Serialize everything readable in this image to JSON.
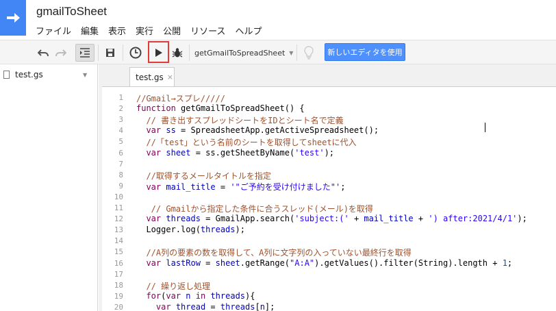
{
  "app": {
    "title": "gmailToSheet"
  },
  "menu": [
    "ファイル",
    "編集",
    "表示",
    "実行",
    "公開",
    "リソース",
    "ヘルプ"
  ],
  "toolbar": {
    "function_name": "getGmailToSpreadSheet",
    "new_editor_label": "新しいエディタを使用"
  },
  "sidebar": {
    "files": [
      {
        "name": "test.gs"
      }
    ]
  },
  "editor": {
    "tab_label": "test.gs",
    "tab_close": "×",
    "lines": [
      {
        "n": "1",
        "parts": [
          {
            "t": "//Gmail→スプレ/////",
            "c": "comment"
          }
        ]
      },
      {
        "n": "2",
        "parts": [
          {
            "t": "function",
            "c": "kw"
          },
          {
            "t": " getGmailToSpreadSheet() {",
            "c": "plain"
          }
        ]
      },
      {
        "n": "3",
        "parts": [
          {
            "t": "  // 書き出すスプレッドシートをIDとシート名で定義",
            "c": "comment"
          }
        ]
      },
      {
        "n": "4",
        "parts": [
          {
            "t": "  ",
            "c": "plain"
          },
          {
            "t": "var",
            "c": "kw"
          },
          {
            "t": " ",
            "c": "plain"
          },
          {
            "t": "ss",
            "c": "var"
          },
          {
            "t": " = SpreadsheetApp.getActiveSpreadsheet(); ",
            "c": "plain"
          }
        ]
      },
      {
        "n": "5",
        "parts": [
          {
            "t": "  //「test」という名前のシートを取得してsheetに代入",
            "c": "comment"
          }
        ]
      },
      {
        "n": "6",
        "parts": [
          {
            "t": "  ",
            "c": "plain"
          },
          {
            "t": "var",
            "c": "kw"
          },
          {
            "t": " ",
            "c": "plain"
          },
          {
            "t": "sheet",
            "c": "var"
          },
          {
            "t": " = ss.getSheetByName(",
            "c": "plain"
          },
          {
            "t": "'test'",
            "c": "str"
          },
          {
            "t": ");",
            "c": "plain"
          }
        ]
      },
      {
        "n": "7",
        "parts": [
          {
            "t": "",
            "c": "plain"
          }
        ]
      },
      {
        "n": "8",
        "parts": [
          {
            "t": "  //取得するメールタイトルを指定",
            "c": "comment"
          }
        ]
      },
      {
        "n": "9",
        "parts": [
          {
            "t": "  ",
            "c": "plain"
          },
          {
            "t": "var",
            "c": "kw"
          },
          {
            "t": " ",
            "c": "plain"
          },
          {
            "t": "mail_title",
            "c": "var"
          },
          {
            "t": " = ",
            "c": "plain"
          },
          {
            "t": "'\"ご予約を受け付けました\"'",
            "c": "str"
          },
          {
            "t": ";",
            "c": "plain"
          }
        ]
      },
      {
        "n": "10",
        "parts": [
          {
            "t": "",
            "c": "plain"
          }
        ]
      },
      {
        "n": "11",
        "parts": [
          {
            "t": "   // Gmailから指定した条件に合うスレッド(メール)を取得",
            "c": "comment"
          }
        ]
      },
      {
        "n": "12",
        "parts": [
          {
            "t": "  ",
            "c": "plain"
          },
          {
            "t": "var",
            "c": "kw"
          },
          {
            "t": " ",
            "c": "plain"
          },
          {
            "t": "threads",
            "c": "var"
          },
          {
            "t": " = GmailApp.search(",
            "c": "plain"
          },
          {
            "t": "'subject:('",
            "c": "str"
          },
          {
            "t": " + ",
            "c": "plain"
          },
          {
            "t": "mail_title",
            "c": "var"
          },
          {
            "t": " + ",
            "c": "plain"
          },
          {
            "t": "') after:2021/4/1'",
            "c": "str"
          },
          {
            "t": ");",
            "c": "plain"
          }
        ]
      },
      {
        "n": "13",
        "parts": [
          {
            "t": "  Logger.log(",
            "c": "plain"
          },
          {
            "t": "threads",
            "c": "var"
          },
          {
            "t": ");",
            "c": "plain"
          }
        ]
      },
      {
        "n": "14",
        "parts": [
          {
            "t": "",
            "c": "plain"
          }
        ]
      },
      {
        "n": "15",
        "parts": [
          {
            "t": "  //A列の要素の数を取得して、A列に文字列の入っていない最終行を取得",
            "c": "comment"
          }
        ]
      },
      {
        "n": "16",
        "parts": [
          {
            "t": "  ",
            "c": "plain"
          },
          {
            "t": "var",
            "c": "kw"
          },
          {
            "t": " ",
            "c": "plain"
          },
          {
            "t": "lastRow",
            "c": "var"
          },
          {
            "t": " = ",
            "c": "plain"
          },
          {
            "t": "sheet",
            "c": "var"
          },
          {
            "t": ".getRange(",
            "c": "plain"
          },
          {
            "t": "\"A:A\"",
            "c": "str"
          },
          {
            "t": ").getValues().filter(String).length + ",
            "c": "plain"
          },
          {
            "t": "1",
            "c": "num"
          },
          {
            "t": ";",
            "c": "plain"
          }
        ]
      },
      {
        "n": "17",
        "parts": [
          {
            "t": "",
            "c": "plain"
          }
        ]
      },
      {
        "n": "18",
        "parts": [
          {
            "t": "  // 繰り返し処理",
            "c": "comment"
          }
        ]
      },
      {
        "n": "19",
        "parts": [
          {
            "t": "  ",
            "c": "plain"
          },
          {
            "t": "for",
            "c": "kw"
          },
          {
            "t": "(",
            "c": "plain"
          },
          {
            "t": "var",
            "c": "kw"
          },
          {
            "t": " ",
            "c": "plain"
          },
          {
            "t": "n",
            "c": "var"
          },
          {
            "t": " ",
            "c": "plain"
          },
          {
            "t": "in",
            "c": "kw"
          },
          {
            "t": " ",
            "c": "plain"
          },
          {
            "t": "threads",
            "c": "var"
          },
          {
            "t": "){",
            "c": "plain"
          }
        ]
      },
      {
        "n": "20",
        "parts": [
          {
            "t": "    ",
            "c": "plain"
          },
          {
            "t": "var",
            "c": "kw"
          },
          {
            "t": " ",
            "c": "plain"
          },
          {
            "t": "thread",
            "c": "var"
          },
          {
            "t": " = ",
            "c": "plain"
          },
          {
            "t": "threads",
            "c": "var"
          },
          {
            "t": "[",
            "c": "plain"
          },
          {
            "t": "n",
            "c": "var"
          },
          {
            "t": "];",
            "c": "plain"
          }
        ]
      }
    ]
  }
}
